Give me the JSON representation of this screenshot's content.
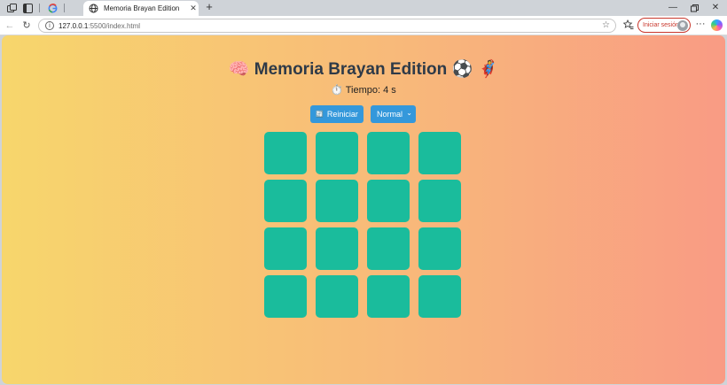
{
  "browser": {
    "tab_title": "Memoria Brayan Edition",
    "url_host": "127.0.0.1",
    "url_path": ":5500/index.html",
    "sign_in_label": "Iniciar sesión",
    "icons": [
      "workspaces-icon",
      "tab-actions-icon",
      "google-icon",
      "globe-icon",
      "close-icon",
      "new-tab-icon",
      "minimize-icon",
      "maximize-icon",
      "window-close-icon",
      "back-icon",
      "reload-icon",
      "site-info-icon",
      "favorite-star-icon",
      "favorites-icon",
      "avatar",
      "more-icon",
      "copilot-icon"
    ]
  },
  "page": {
    "title_emoji_left": "🧠",
    "title": "Memoria Brayan Edition",
    "title_emoji_right": "⚽ 🦸",
    "timer_icon": "⏱️",
    "timer_text": "Tiempo: 4 s",
    "reset_icon": "🔄",
    "reset_label": "Reiniciar",
    "difficulty_selected": "Normal",
    "card_color": "#1abc9c",
    "button_color": "#3498db",
    "title_color": "#2e3a48",
    "cards": [
      "",
      "",
      "",
      "",
      "",
      "",
      "",
      "",
      "",
      "",
      "",
      "",
      "",
      "",
      "",
      ""
    ]
  }
}
